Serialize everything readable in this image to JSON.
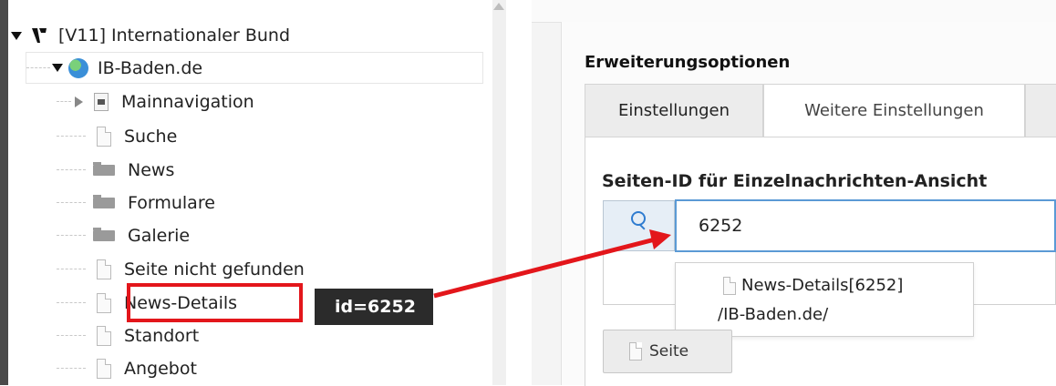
{
  "page_tree": {
    "root": {
      "label": "[V11] Internationaler Bund",
      "icon": "typo3-logo-icon"
    },
    "site": {
      "label": "IB-Baden.de",
      "icon": "globe-icon"
    },
    "items": [
      {
        "label": "Mainnavigation",
        "icon": "shortcut-page-icon"
      },
      {
        "label": "Suche",
        "icon": "page-icon"
      },
      {
        "label": "News",
        "icon": "folder-icon"
      },
      {
        "label": "Formulare",
        "icon": "folder-icon"
      },
      {
        "label": "Galerie",
        "icon": "folder-icon"
      },
      {
        "label": "Seite nicht gefunden",
        "icon": "page-icon"
      },
      {
        "label": "News-Details",
        "icon": "page-icon"
      },
      {
        "label": "Standort",
        "icon": "page-icon"
      },
      {
        "label": "Angebot",
        "icon": "page-icon"
      }
    ]
  },
  "tooltip": {
    "text": "id=6252"
  },
  "form": {
    "section_title": "Erweiterungsoptionen",
    "tabs": [
      {
        "label": "Einstellungen"
      },
      {
        "label": "Weitere Einstellungen",
        "active": true
      }
    ],
    "field_label": "Seiten-ID für Einzelnachrichten-Ansicht",
    "field_value": "6252",
    "suggestion": {
      "title": "News-Details[6252]",
      "path": "/IB-Baden.de/"
    },
    "page_button_label": "Seite"
  },
  "colors": {
    "highlight": "#e3161b",
    "arrow": "#e3161b",
    "tooltip_bg": "#2b2b2b",
    "input_border": "#5b9ad5"
  }
}
